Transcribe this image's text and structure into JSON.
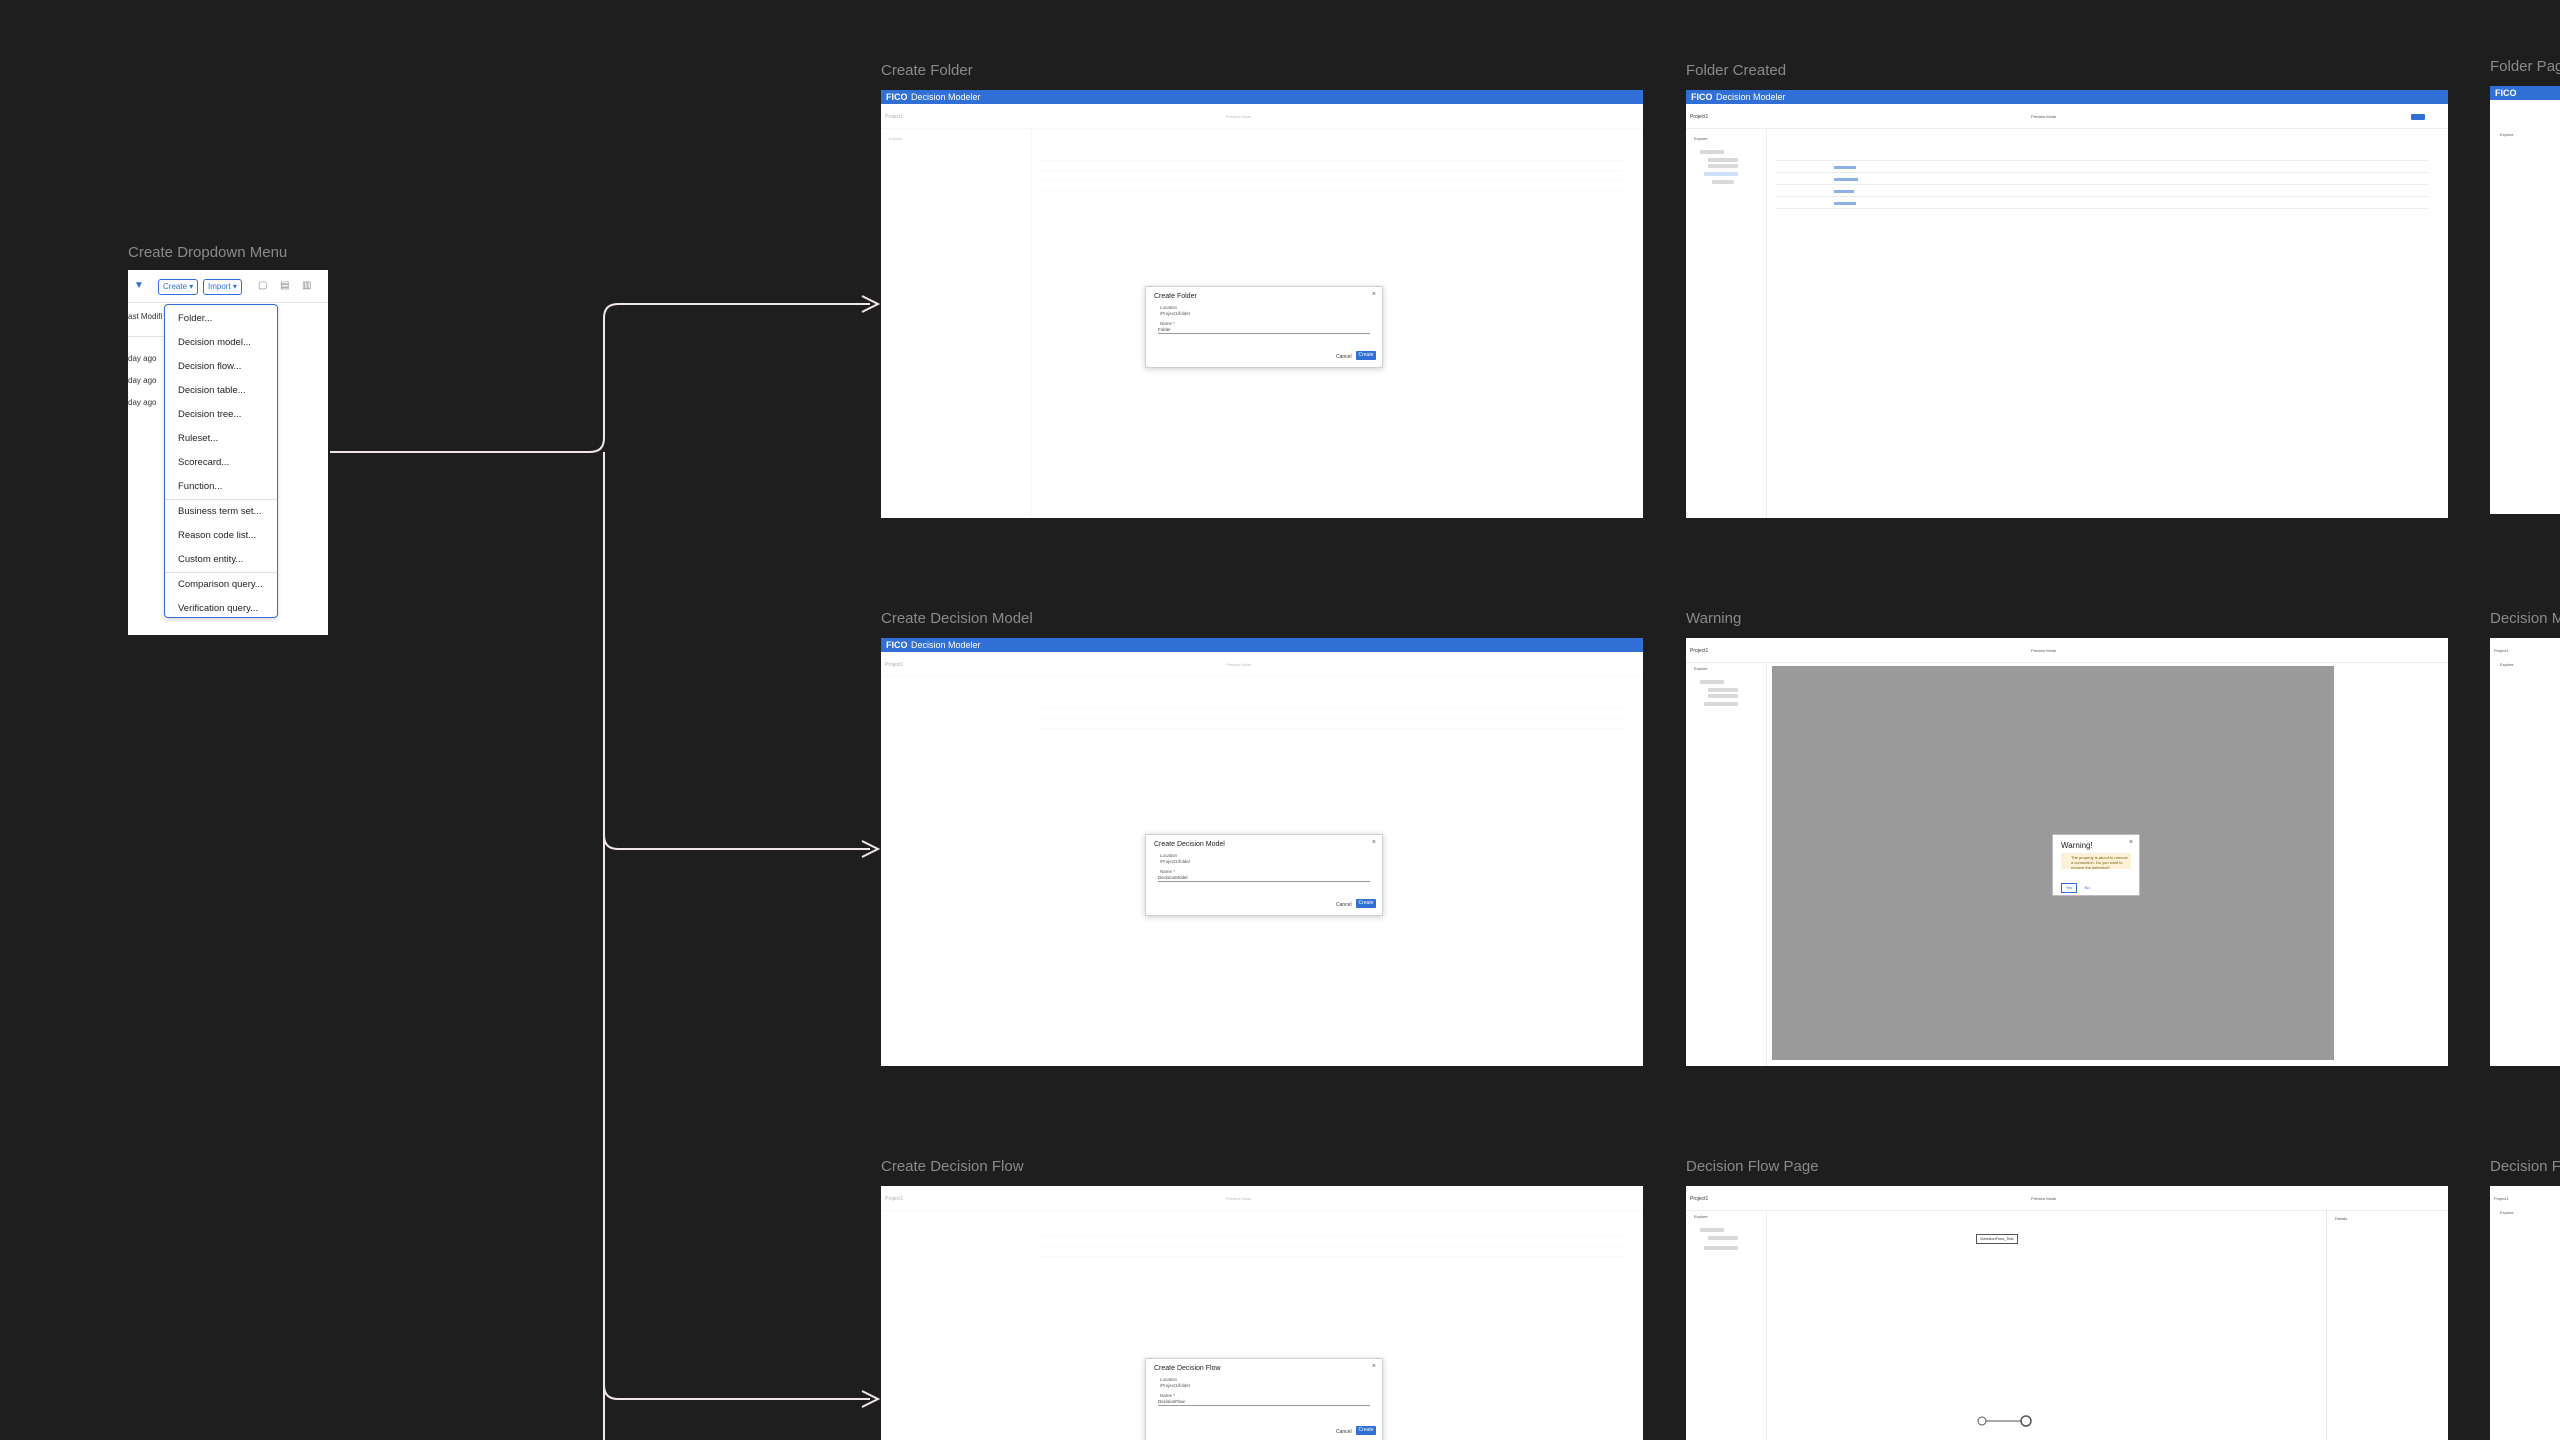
{
  "frames": {
    "dropdown": {
      "label": "Create Dropdown Menu"
    },
    "create_folder": {
      "label": "Create Folder"
    },
    "folder_created": {
      "label": "Folder Created"
    },
    "folder_page": {
      "label": "Folder Pag"
    },
    "create_decision_model": {
      "label": "Create Decision Model"
    },
    "warning": {
      "label": "Warning"
    },
    "decision_model_partial": {
      "label": "Decision M"
    },
    "create_decision_flow": {
      "label": "Create Decision Flow"
    },
    "decision_flow_page": {
      "label": "Decision Flow Page"
    },
    "decision_flow_partial": {
      "label": "Decision F"
    }
  },
  "dropdown": {
    "create_label": "Create ▾",
    "import_label": "Import ▾",
    "left_column": [
      "ast Modifi",
      "day ago",
      "day ago",
      "day ago"
    ],
    "menu_items": [
      "Folder...",
      "Decision model...",
      "Decision flow...",
      "Decision table...",
      "Decision tree...",
      "Ruleset...",
      "Scorecard...",
      "Function...",
      "Business term set...",
      "Reason code list...",
      "Custom entity...",
      "Comparison query...",
      "Verification query..."
    ]
  },
  "app": {
    "logo": "FICO",
    "product": "Decision Modeler",
    "project": "Project1",
    "explore": "Explore",
    "preview_mode": "Preview Mode"
  },
  "dialogs": {
    "folder": {
      "title": "Create Folder",
      "location_label": "Location",
      "location_value": "/Project1/folder",
      "name_label": "Name *",
      "name_value": "Folder",
      "cancel": "Cancel",
      "create": "Create"
    },
    "model": {
      "title": "Create Decision Model",
      "location_label": "Location",
      "location_value": "/Project1/folder",
      "name_label": "Name *",
      "name_value": "DecisionModel",
      "cancel": "Cancel",
      "create": "Create"
    },
    "flow": {
      "title": "Create Decision Flow",
      "location_label": "Location",
      "location_value": "/Project1/folder",
      "name_label": "Name *",
      "name_value": "DecisionFlow",
      "cancel": "Cancel",
      "create": "Create"
    }
  },
  "warning": {
    "title": "Warning!",
    "message": "The property is about to remove a connection. Do you want to remove the selection?",
    "yes": "Yes",
    "no": "No"
  },
  "flow_page": {
    "node": "DecisionFlow_Test",
    "details": "Details"
  }
}
